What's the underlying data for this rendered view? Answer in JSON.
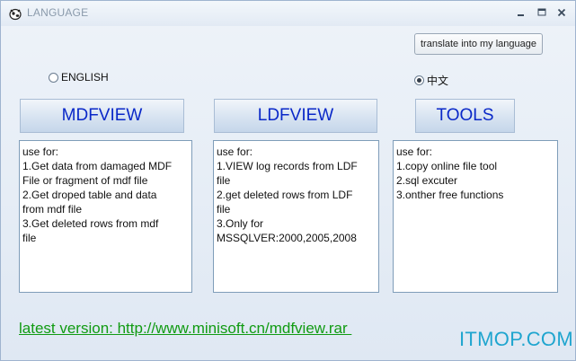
{
  "window": {
    "title": "LANGUAGE",
    "icon": "cow-icon",
    "controls": [
      "minimize-icon",
      "maximize-icon",
      "close-icon"
    ]
  },
  "translate_button": {
    "label": "translate into my language"
  },
  "language": {
    "english": {
      "label": "ENGLISH",
      "checked": false
    },
    "chinese": {
      "label": "中文",
      "checked": true
    }
  },
  "tabs": [
    {
      "label": "MDFVIEW"
    },
    {
      "label": "LDFVIEW"
    },
    {
      "label": "TOOLS"
    }
  ],
  "descriptions": {
    "mdfview": [
      "use for:",
      "1.Get data from damaged MDF",
      "File or fragment of mdf file",
      "2.Get droped table and data",
      "from mdf file",
      "3.Get deleted rows  from mdf",
      "file"
    ],
    "ldfview": [
      "use for:",
      "1.VIEW log records from LDF",
      "file",
      "2.get deleted rows from LDF",
      "file",
      "3.Only for",
      "MSSQLVER:2000,2005,2008"
    ],
    "tools": [
      "use for:",
      "1.copy online file tool",
      "2.sql excuter",
      "3.onther free functions"
    ]
  },
  "footer_link": "latest version: http://www.minisoft.cn/mdfview.rar ",
  "watermark": "ITMOP.COM",
  "colors": {
    "tab_text": "#0a28c8",
    "link": "#119b13",
    "watermark": "#1fa5cf"
  }
}
